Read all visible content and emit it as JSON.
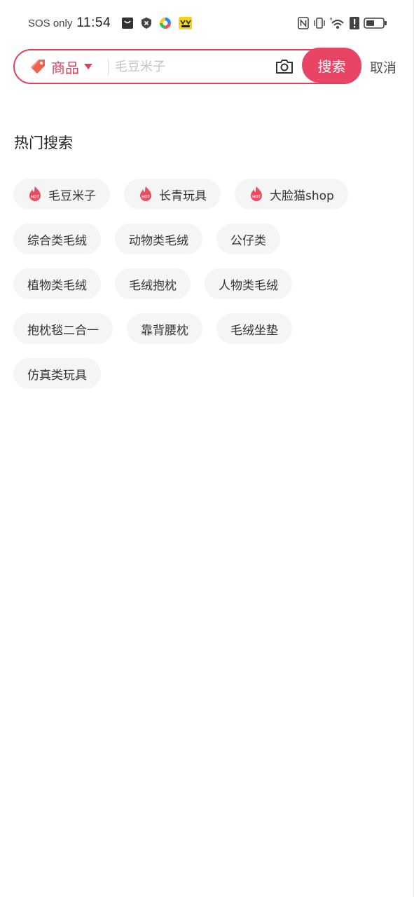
{
  "status_bar": {
    "carrier": "SOS only",
    "time": "11:54"
  },
  "search": {
    "category_label": "商品",
    "placeholder": "毛豆米子",
    "search_button": "搜索",
    "cancel_label": "取消"
  },
  "hot_search": {
    "title": "热门搜索",
    "hot_tags": [
      "毛豆米子",
      "长青玩具",
      "大脸猫shop"
    ],
    "rows": [
      [
        "综合类毛绒",
        "动物类毛绒",
        "公仔类"
      ],
      [
        "植物类毛绒",
        "毛绒抱枕",
        "人物类毛绒"
      ],
      [
        "抱枕毯二合一",
        "靠背腰枕",
        "毛绒坐垫"
      ],
      [
        "仿真类玩具"
      ]
    ]
  },
  "colors": {
    "accent": "#e84465",
    "border": "#e0405a",
    "tag_bg": "#f5f5f5"
  }
}
